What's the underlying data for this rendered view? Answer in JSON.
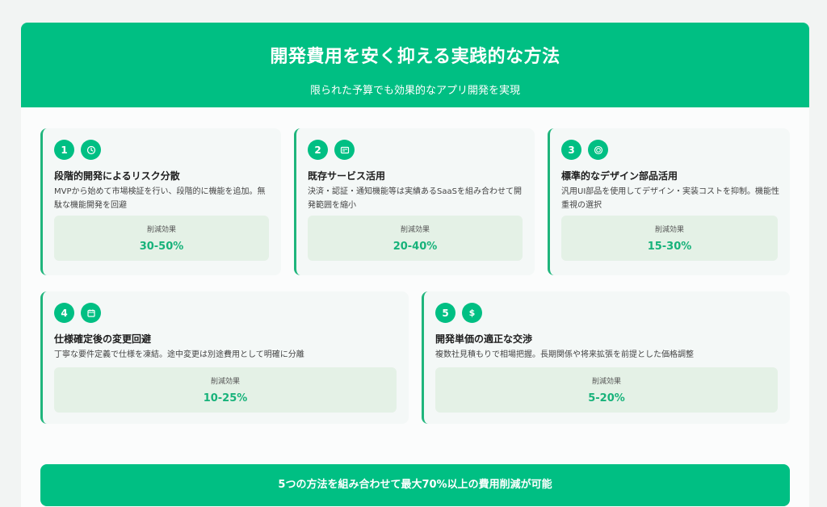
{
  "header": {
    "title": "開発費用を安く抑える実践的な方法",
    "subtitle": "限られた予算でも効果的なアプリ開発を実現"
  },
  "effect_label": "削減効果",
  "methods": [
    {
      "number": "1",
      "icon": "clock-icon",
      "title": "段階的開発によるリスク分散",
      "description": "MVPから始めて市場検証を行い、段階的に機能を追加。無駄な機能開発を回避",
      "effect": "30-50%"
    },
    {
      "number": "2",
      "icon": "card-icon",
      "title": "既存サービス活用",
      "description": "決済・認証・通知機能等は実績あるSaaSを組み合わせて開発範囲を縮小",
      "effect": "20-40%"
    },
    {
      "number": "3",
      "icon": "target-icon",
      "title": "標準的なデザイン部品活用",
      "description": "汎用UI部品を使用してデザイン・実装コストを抑制。機能性重視の選択",
      "effect": "15-30%"
    },
    {
      "number": "4",
      "icon": "calendar-icon",
      "title": "仕様確定後の変更回避",
      "description": "丁寧な要件定義で仕様を凍結。途中変更は別途費用として明確に分離",
      "effect": "10-25%"
    },
    {
      "number": "5",
      "icon": "dollar-icon",
      "title": "開発単価の適正な交渉",
      "description": "複数社見積もりで相場把握。長期関係や将来拡張を前提とした価格調整",
      "effect": "5-20%"
    }
  ],
  "footer": {
    "text": "5つの方法を組み合わせて最大70%以上の費用削減が可能"
  },
  "colors": {
    "accent": "#00bf83",
    "effect_bg": "#e4f1e6",
    "card_bg": "#f4f8f7"
  }
}
